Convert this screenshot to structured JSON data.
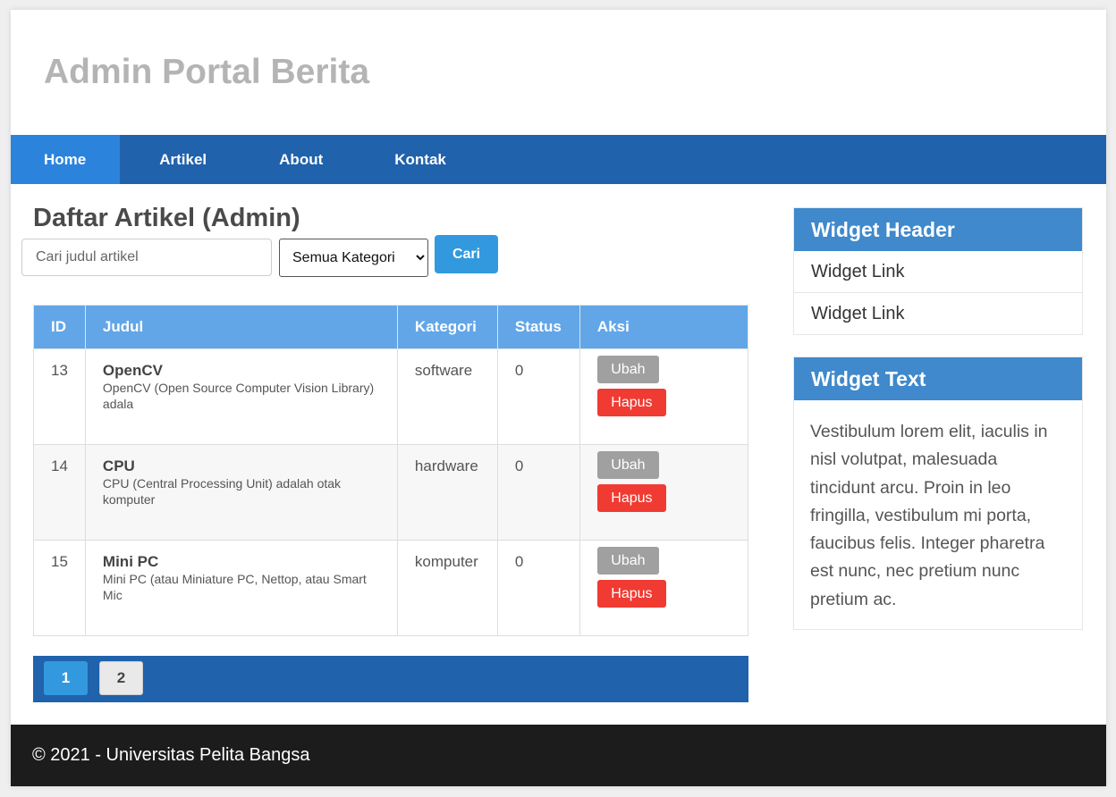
{
  "header": {
    "title": "Admin Portal Berita"
  },
  "nav": [
    {
      "label": "Home",
      "active": true
    },
    {
      "label": "Artikel",
      "active": false
    },
    {
      "label": "About",
      "active": false
    },
    {
      "label": "Kontak",
      "active": false
    }
  ],
  "main": {
    "page_title": "Daftar Artikel (Admin)",
    "search": {
      "placeholder": "Cari judul artikel",
      "value": ""
    },
    "category_select": {
      "selected": "Semua Kategori"
    },
    "search_button": "Cari",
    "table": {
      "headers": [
        "ID",
        "Judul",
        "Kategori",
        "Status",
        "Aksi"
      ],
      "rows": [
        {
          "id": "13",
          "title": "OpenCV",
          "excerpt": "OpenCV (Open Source Computer Vision Library) adala",
          "category": "software",
          "status": "0",
          "edit": "Ubah",
          "delete": "Hapus"
        },
        {
          "id": "14",
          "title": "CPU",
          "excerpt": "CPU (Central Processing Unit) adalah otak komputer",
          "category": "hardware",
          "status": "0",
          "edit": "Ubah",
          "delete": "Hapus"
        },
        {
          "id": "15",
          "title": "Mini PC",
          "excerpt": "Mini PC (atau Miniature PC, Nettop, atau Smart Mic",
          "category": "komputer",
          "status": "0",
          "edit": "Ubah",
          "delete": "Hapus"
        }
      ]
    },
    "pagination": {
      "pages": [
        "1",
        "2"
      ],
      "current": "1"
    }
  },
  "sidebar": {
    "widget_links": {
      "header": "Widget Header",
      "links": [
        "Widget Link",
        "Widget Link"
      ]
    },
    "widget_text": {
      "header": "Widget Text",
      "body": "Vestibulum lorem elit, iaculis in nisl volutpat, malesuada tincidunt arcu. Proin in leo fringilla, vestibulum mi porta, faucibus felis. Integer pharetra est nunc, nec pretium nunc pretium ac."
    }
  },
  "footer": {
    "text": "© 2021 - Universitas Pelita Bangsa"
  },
  "colors": {
    "nav_bg": "#2062ab",
    "nav_active": "#2b83dc",
    "table_header": "#62a6e8",
    "primary_button": "#3299de",
    "edit_button": "#a0a0a0",
    "delete_button": "#f03b33",
    "widget_header": "#3f89cc",
    "footer_bg": "#1c1c1c"
  }
}
